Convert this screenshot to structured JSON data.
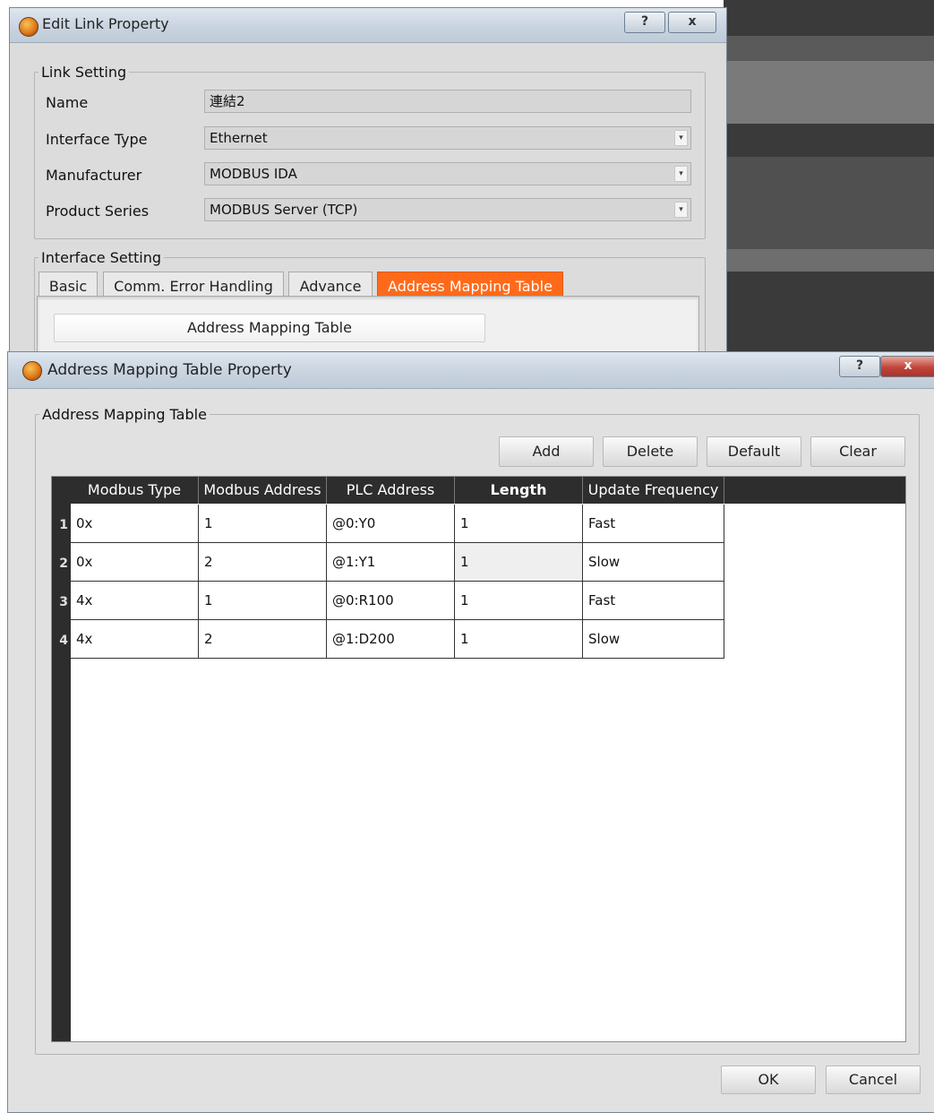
{
  "edit_link_dialog": {
    "title": "Edit Link Property",
    "help_label": "?",
    "close_label": "x",
    "link_setting": {
      "legend": "Link Setting",
      "name": {
        "label": "Name",
        "value": "連結2"
      },
      "interface_type": {
        "label": "Interface Type",
        "value": "Ethernet"
      },
      "manufacturer": {
        "label": "Manufacturer",
        "value": "MODBUS IDA"
      },
      "product_series": {
        "label": "Product Series",
        "value": "MODBUS Server (TCP)"
      }
    },
    "interface_setting": {
      "legend": "Interface Setting",
      "tabs": [
        "Basic",
        "Comm. Error Handling",
        "Advance",
        "Address Mapping Table"
      ],
      "active_tab": "Address Mapping Table",
      "panel_button": "Address Mapping Table"
    }
  },
  "mapping_dialog": {
    "title": "Address Mapping Table Property",
    "help_label": "?",
    "close_label": "x",
    "group_legend": "Address Mapping Table",
    "toolbar": {
      "add": "Add",
      "delete": "Delete",
      "default": "Default",
      "clear": "Clear"
    },
    "table": {
      "columns": [
        "Modbus Type",
        "Modbus Address",
        "PLC Address",
        "Length",
        "Update Frequency"
      ],
      "rows": [
        {
          "num": "1",
          "type": "0x",
          "address": "1",
          "plc": "@0:Y0",
          "length": "1",
          "freq": "Fast"
        },
        {
          "num": "2",
          "type": "0x",
          "address": "2",
          "plc": "@1:Y1",
          "length": "1",
          "freq": "Slow"
        },
        {
          "num": "3",
          "type": "4x",
          "address": "1",
          "plc": "@0:R100",
          "length": "1",
          "freq": "Fast"
        },
        {
          "num": "4",
          "type": "4x",
          "address": "2",
          "plc": "@1:D200",
          "length": "1",
          "freq": "Slow"
        }
      ]
    },
    "ok": "OK",
    "cancel": "Cancel"
  },
  "colors": {
    "accent_tab": "#ff6a1a",
    "grid_header": "#2d2d2d"
  }
}
